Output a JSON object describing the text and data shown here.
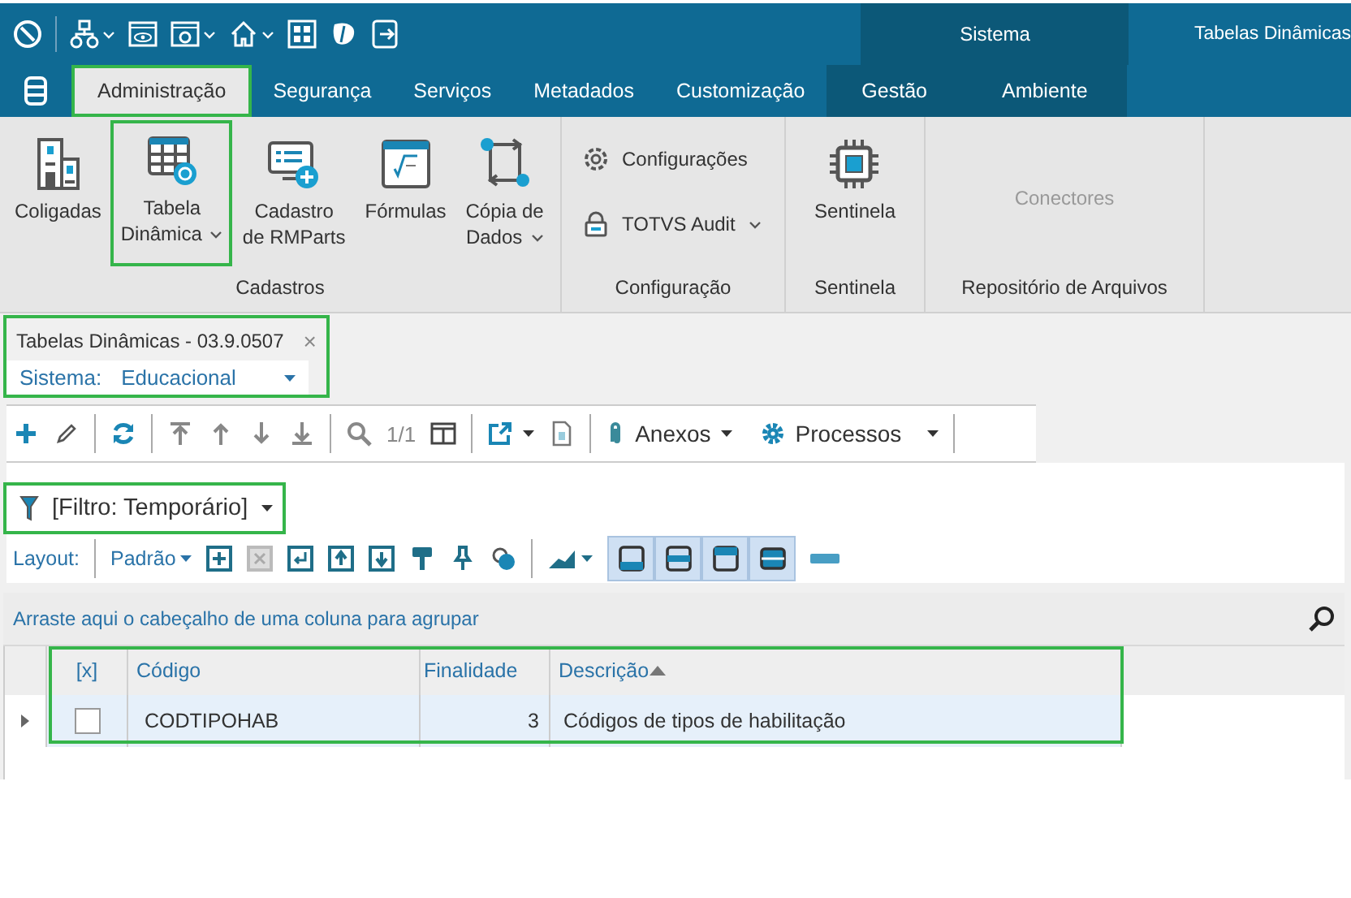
{
  "contextual_group": {
    "title": "Sistema"
  },
  "window_title": "Tabelas Dinâmicas",
  "menu_tabs": [
    {
      "label": "Administração",
      "selected": true,
      "highlighted": true,
      "contextual": false
    },
    {
      "label": "Segurança",
      "selected": false,
      "highlighted": false,
      "contextual": false
    },
    {
      "label": "Serviços",
      "selected": false,
      "highlighted": false,
      "contextual": false
    },
    {
      "label": "Metadados",
      "selected": false,
      "highlighted": false,
      "contextual": false
    },
    {
      "label": "Customização",
      "selected": false,
      "highlighted": false,
      "contextual": false
    },
    {
      "label": "Gestão",
      "selected": false,
      "highlighted": false,
      "contextual": true
    },
    {
      "label": "Ambiente",
      "selected": false,
      "highlighted": false,
      "contextual": true
    }
  ],
  "ribbon_groups": [
    {
      "title": "Cadastros",
      "items": [
        {
          "kind": "large",
          "label": "Coligadas",
          "dropdown": false,
          "highlighted": false,
          "disabled": false
        },
        {
          "kind": "large",
          "label": "Tabela\nDinâmica",
          "dropdown": true,
          "highlighted": true,
          "disabled": false
        },
        {
          "kind": "large",
          "label": "Cadastro\nde RMParts",
          "dropdown": false,
          "highlighted": false,
          "disabled": false
        },
        {
          "kind": "large",
          "label": "Fórmulas",
          "dropdown": false,
          "highlighted": false,
          "disabled": false
        },
        {
          "kind": "large",
          "label": "Cópia de\nDados",
          "dropdown": true,
          "highlighted": false,
          "disabled": false
        }
      ]
    },
    {
      "title": "Configuração",
      "items": [
        {
          "kind": "small",
          "label": "Configurações",
          "dropdown": false,
          "highlighted": false,
          "disabled": false
        },
        {
          "kind": "small",
          "label": "TOTVS Audit",
          "dropdown": true,
          "highlighted": false,
          "disabled": false
        }
      ]
    },
    {
      "title": "Sentinela",
      "items": [
        {
          "kind": "large",
          "label": "Sentinela",
          "dropdown": false,
          "highlighted": false,
          "disabled": false
        }
      ]
    },
    {
      "title": "Repositório de Arquivos",
      "items": [
        {
          "kind": "text",
          "label": "Conectores",
          "dropdown": false,
          "highlighted": false,
          "disabled": true
        }
      ]
    }
  ],
  "document_tab": {
    "title": "Tabelas Dinâmicas - 03.9.0507",
    "close": "×",
    "highlighted": true,
    "system_label": "Sistema:",
    "system_value": "Educacional"
  },
  "toolbar": {
    "page": "1/1",
    "attachments": "Anexos",
    "processes": "Processos"
  },
  "filter": {
    "label": "[Filtro: Temporário]",
    "highlighted": true
  },
  "layout_bar": {
    "label": "Layout:",
    "preset": "Padrão",
    "views": [
      {
        "selected": true
      },
      {
        "selected": true
      },
      {
        "selected": true
      },
      {
        "selected": true
      }
    ]
  },
  "group_panel": {
    "hint": "Arraste aqui o cabeçalho de uma coluna para agrupar"
  },
  "table": {
    "highlighted": true,
    "columns": [
      {
        "label": "[x]",
        "sorted": false
      },
      {
        "label": "Código",
        "sorted": false
      },
      {
        "label": "Finalidade",
        "sorted": false
      },
      {
        "label": "Descrição",
        "sorted": true
      }
    ],
    "rows": [
      {
        "selected": true,
        "checked": false,
        "cells": [
          "",
          "CODTIPOHAB",
          "3",
          "Códigos de tipos de habilitação"
        ]
      }
    ]
  }
}
